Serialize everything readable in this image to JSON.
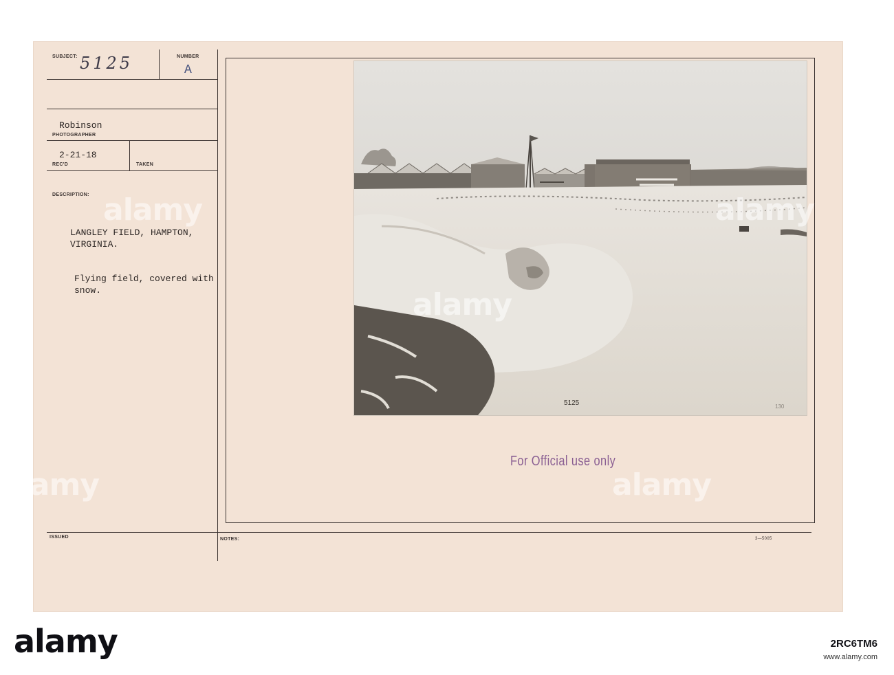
{
  "record": {
    "subject_label": "SUBJECT:",
    "subject_value": "5125",
    "number_label": "NUMBER",
    "number_value": "A",
    "photographer_name": "Robinson",
    "photographer_label": "PHOTOGRAPHER",
    "recd_value": "2-21-18",
    "recd_label": "REC'D",
    "taken_label": "TAKEN",
    "description_label": "DESCRIPTION:",
    "description_line1": "LANGLEY FIELD, HAMPTON,",
    "description_line2": "VIRGINIA.",
    "description_line3": "Flying field, covered with",
    "description_line4": "snow.",
    "issued_label": "ISSUED",
    "notes_label": "NOTES:",
    "form_code": "3—5005"
  },
  "photo": {
    "negative_number": "5125",
    "corner_mark": "130"
  },
  "stamp": {
    "text": "For Official use only"
  },
  "watermark": {
    "text": "alamy"
  },
  "footer": {
    "logo": "alamy",
    "image_code": "2RC6TM6",
    "url": "www.alamy.com"
  },
  "colors": {
    "card": "#f3e3d6",
    "stamp": "#8a5f93",
    "ink": "#2a2422"
  }
}
